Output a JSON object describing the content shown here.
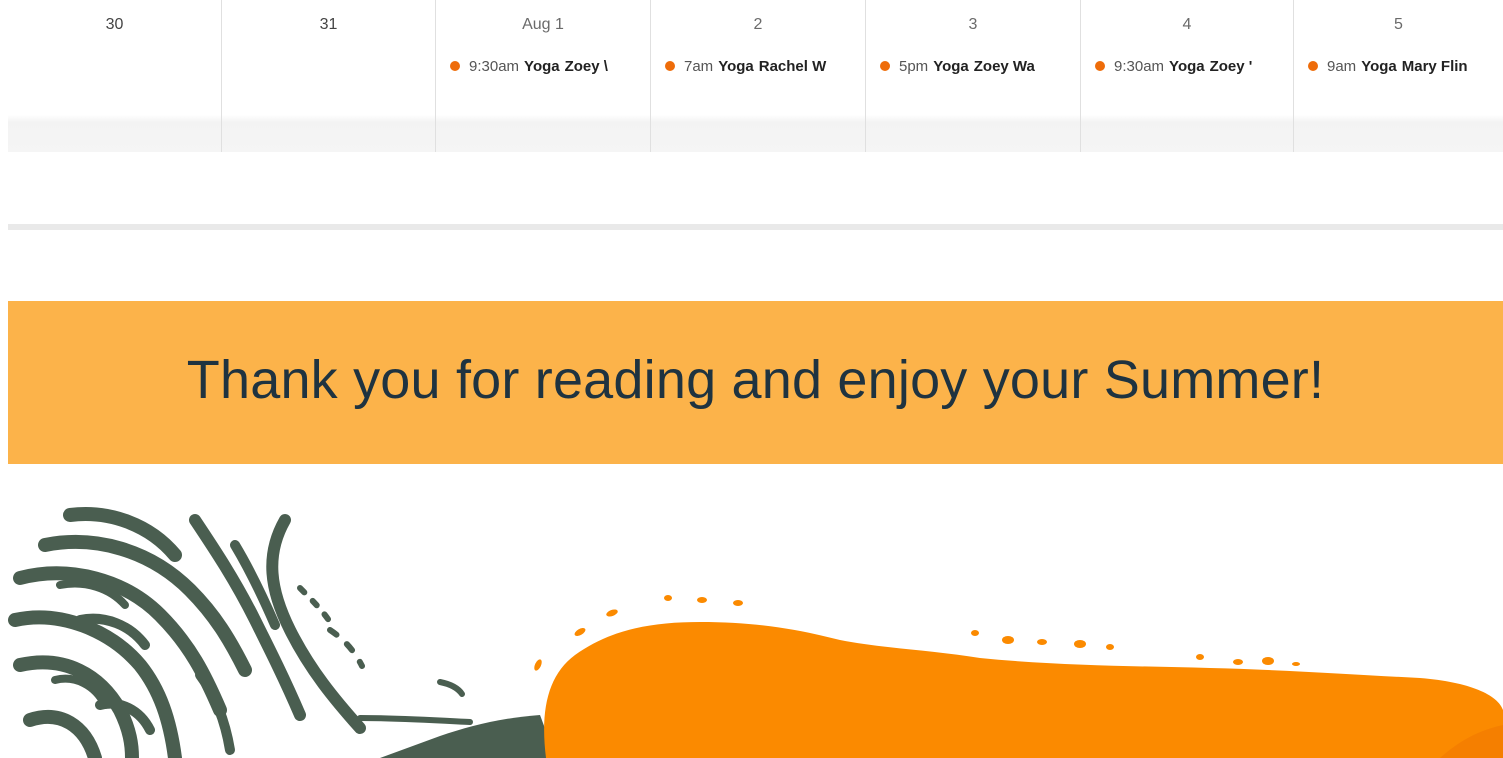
{
  "calendar": {
    "days": [
      {
        "label": "30"
      },
      {
        "label": "31"
      },
      {
        "label": "Aug 1",
        "event": {
          "time": "9:30am",
          "title": "Yoga",
          "who": "Zoey \\"
        }
      },
      {
        "label": "2",
        "event": {
          "time": "7am",
          "title": "Yoga",
          "who": "Rachel W"
        }
      },
      {
        "label": "3",
        "event": {
          "time": "5pm",
          "title": "Yoga",
          "who": "Zoey Wa"
        }
      },
      {
        "label": "4",
        "event": {
          "time": "9:30am",
          "title": "Yoga",
          "who": "Zoey '"
        }
      },
      {
        "label": "5",
        "event": {
          "time": "9am",
          "title": "Yoga",
          "who": "Mary Flin"
        }
      }
    ],
    "event_color": "#ee6c0a"
  },
  "banner": {
    "text": "Thank you for reading and enjoy your Summer!",
    "background": "#fcb34a",
    "text_color": "#1f3340"
  },
  "decor": {
    "wave_color": "#4a5e50",
    "sun_color": "#fb8a00"
  }
}
